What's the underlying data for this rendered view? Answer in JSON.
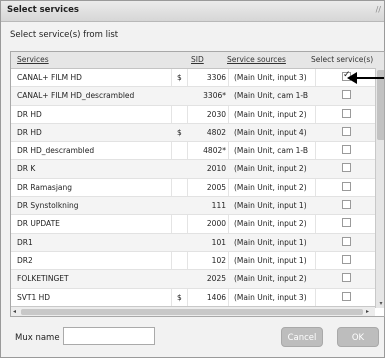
{
  "dialog": {
    "title": "Select services",
    "subtitle": "Select service(s) from list",
    "grip": "//"
  },
  "table": {
    "headers": {
      "services": "Services",
      "sid": "SID",
      "sources": "Service sources",
      "select": "Select service(s)"
    },
    "rows": [
      {
        "name": "CANAL+ FILM HD",
        "currency": "$",
        "sid": "3306",
        "source": "(Main Unit, input 3)",
        "checked": true
      },
      {
        "name": "CANAL+ FILM HD_descrambled",
        "currency": "",
        "sid": "3306*",
        "source": "(Main Unit, cam 1-B",
        "checked": false
      },
      {
        "name": "DR HD",
        "currency": "",
        "sid": "2030",
        "source": "(Main Unit, input 2)",
        "checked": false
      },
      {
        "name": "DR HD",
        "currency": "$",
        "sid": "4802",
        "source": "(Main Unit, input 4)",
        "checked": false
      },
      {
        "name": "DR HD_descrambled",
        "currency": "",
        "sid": "4802*",
        "source": "(Main Unit, cam 1-B",
        "checked": false
      },
      {
        "name": "DR K",
        "currency": "",
        "sid": "2010",
        "source": "(Main Unit, input 2)",
        "checked": false
      },
      {
        "name": "DR Ramasjang",
        "currency": "",
        "sid": "2005",
        "source": "(Main Unit, input 2)",
        "checked": false
      },
      {
        "name": "DR Synstolkning",
        "currency": "",
        "sid": "111",
        "source": "(Main Unit, input 1)",
        "checked": false
      },
      {
        "name": "DR UPDATE",
        "currency": "",
        "sid": "2000",
        "source": "(Main Unit, input 2)",
        "checked": false
      },
      {
        "name": "DR1",
        "currency": "",
        "sid": "101",
        "source": "(Main Unit, input 1)",
        "checked": false
      },
      {
        "name": "DR2",
        "currency": "",
        "sid": "102",
        "source": "(Main Unit, input 1)",
        "checked": false
      },
      {
        "name": "FOLKETINGET",
        "currency": "",
        "sid": "2025",
        "source": "(Main Unit, input 2)",
        "checked": false
      },
      {
        "name": "SVT1 HD",
        "currency": "$",
        "sid": "1406",
        "source": "(Main Unit, input 3)",
        "checked": false
      },
      {
        "name": "SVT1 HD_descrambled",
        "currency": "",
        "sid": "1406*",
        "source": "(Main Unit, cam 1-B",
        "checked": false
      }
    ]
  },
  "footer": {
    "mux_label": "Mux name",
    "mux_value": "",
    "cancel_label": "Cancel",
    "ok_label": "OK"
  },
  "scroll": {
    "left_arrow": "◂",
    "right_arrow": "▸",
    "down_arrow": "▾"
  },
  "icons": {
    "check": "✓",
    "pointer_arrow": "arrow-left-icon"
  }
}
